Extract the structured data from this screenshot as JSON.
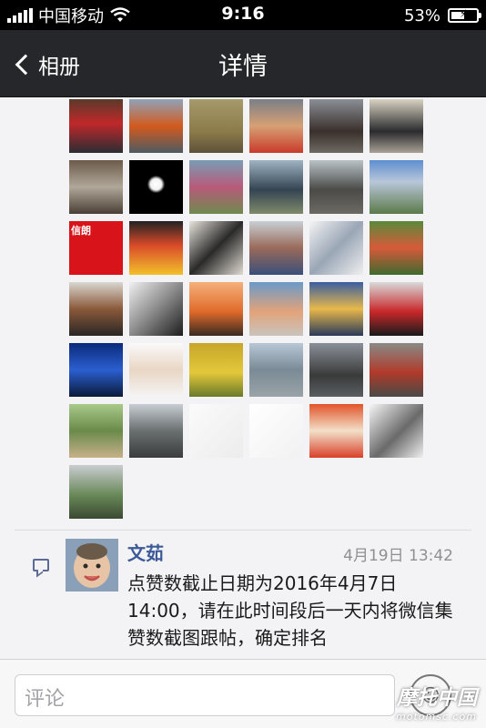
{
  "status_bar": {
    "carrier": "中国移动",
    "time": "9:16",
    "battery_percent": "53%",
    "battery_level": 0.53
  },
  "nav": {
    "back_label": "相册",
    "title": "详情"
  },
  "likes": {
    "thumbnails": [
      {
        "bg": "linear-gradient(180deg,#5a3a2a 0%,#c0282a 45%,#2b2d33 100%)"
      },
      {
        "bg": "linear-gradient(180deg,#8fa3b8 0%,#d35a1e 50%,#4e5a62 100%)"
      },
      {
        "bg": "linear-gradient(180deg,#a59a6a 0%,#8c7b4a 60%,#5d5238 100%)"
      },
      {
        "bg": "linear-gradient(180deg,#7a7f88 0%,#d7a074 50%,#c93a2a 100%)"
      },
      {
        "bg": "linear-gradient(180deg,#8a8e95 0%,#3a302c 60%,#6e6a62 100%)"
      },
      {
        "bg": "linear-gradient(180deg,#d8d2c2 0%,#2b2b2e 60%,#a7a095 100%)"
      },
      {
        "bg": "linear-gradient(180deg,#6c5a4a 0%,#b0a89a 50%,#4a3f35 100%)"
      },
      {
        "bg": "radial-gradient(circle at 50% 45%,#ffffff 0%,#f2f2f2 14%,#000 22%)"
      },
      {
        "bg": "linear-gradient(180deg,#7a9db5 0%,#b85a7a 50%,#6f8a4f 100%)"
      },
      {
        "bg": "linear-gradient(180deg,#9fb3c2 0%,#344452 55%,#7f8a6a 100%)"
      },
      {
        "bg": "linear-gradient(180deg,#b9c2c6 0%,#4a4a48 55%,#6d6a64 100%)"
      },
      {
        "bg": "linear-gradient(180deg,#5d8fd0 0%,#b9c6d9 40%,#5b7a4a 100%)"
      },
      {
        "bg": "#d8141a",
        "label": "信朗"
      },
      {
        "bg": "linear-gradient(180deg,#222 0%,#d94a2a 45%,#f2c12a 100%)"
      },
      {
        "bg": "linear-gradient(135deg,#e8e4dc 0%,#2a2a2a 50%,#e0dbd2 100%)"
      },
      {
        "bg": "linear-gradient(180deg,#c8cfd4 0%,#9a6a5a 50%,#3a4f7a 100%)"
      },
      {
        "bg": "linear-gradient(135deg,#f4f4f4 0%,#9aa6b6 50%,#efefef 100%)"
      },
      {
        "bg": "linear-gradient(180deg,#5a8a3a 0%,#d65a3a 50%,#3f6a2e 100%)"
      },
      {
        "bg": "linear-gradient(180deg,#d9d6d0 0%,#8a5a3a 50%,#2a2624 100%)"
      },
      {
        "bg": "linear-gradient(135deg,#f0f0f0 0%,#8a8a8a 50%,#1c1c1c 100%)"
      },
      {
        "bg": "linear-gradient(180deg,#f4b07a 0%,#e06a2a 55%,#3a2a22 100%)"
      },
      {
        "bg": "linear-gradient(180deg,#6a9ac8 0%,#e2a37a 55%,#c9c4bd 100%)"
      },
      {
        "bg": "linear-gradient(180deg,#3a5ea0 0%,#e8b84a 50%,#2a3a5a 100%)"
      },
      {
        "bg": "linear-gradient(180deg,#d9d9d9 0%,#c8272a 55%,#1a1a1a 100%)"
      },
      {
        "bg": "linear-gradient(180deg,#0a2a7a 0%,#2b5fd0 50%,#0a1a3a 100%)"
      },
      {
        "bg": "linear-gradient(180deg,#fafafa 0%,#e9d6c4 50%,#f4f4f4 100%)"
      },
      {
        "bg": "linear-gradient(180deg,#c7a62a 0%,#e3c83a 55%,#6a7a2a 100%)"
      },
      {
        "bg": "linear-gradient(180deg,#b7c7d6 0%,#7a8a96 50%,#9aa4a8 100%)"
      },
      {
        "bg": "linear-gradient(180deg,#8a9098 0%,#3a3a3a 60%,#5a5e62 100%)"
      },
      {
        "bg": "linear-gradient(180deg,#8a8a86 0%,#b03a2a 55%,#4a4a46 100%)"
      },
      {
        "bg": "linear-gradient(180deg,#a9c98a 0%,#6a8a4a 50%,#c7b08a 100%)"
      },
      {
        "bg": "linear-gradient(180deg,#c7cdd2 0%,#6a7070 50%,#3a3c3e 100%)"
      },
      {
        "bg": "linear-gradient(135deg,#fbfbfb 0%,#ececec 100%)"
      },
      {
        "bg": "linear-gradient(135deg,#ffffff 0%,#f1f1f1 100%)"
      },
      {
        "bg": "linear-gradient(180deg,#e1532a 0%,#f2e0c8 50%,#d9402a 100%)"
      },
      {
        "bg": "linear-gradient(135deg,#f6f6f6 0%,#6a6a6a 55%,#efefef 100%)"
      },
      {
        "bg": "linear-gradient(180deg,#c9ccd0 0%,#6a8a5a 55%,#3a4a32 100%)"
      }
    ]
  },
  "comment": {
    "author": "文茹",
    "timestamp": "4月19日 13:42",
    "text": "点赞数截止日期为2016年4月7日14:00，请在此时间段后一天内将微信集赞数截图跟帖，确定排名"
  },
  "input_bar": {
    "placeholder": "评论"
  },
  "watermark": {
    "title": "摩托中国",
    "url": "motomsc.com"
  }
}
